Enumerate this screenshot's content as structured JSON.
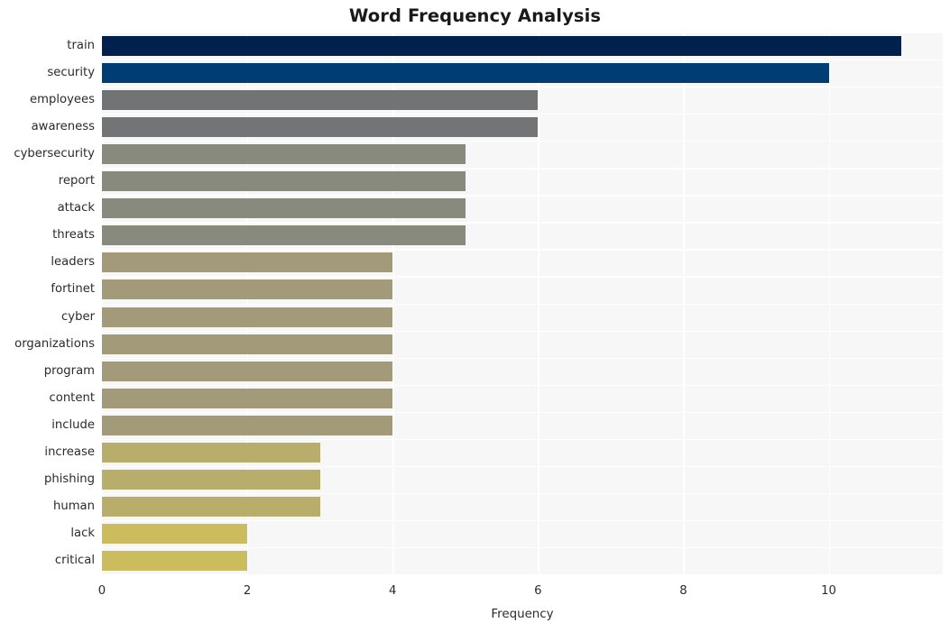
{
  "chart_data": {
    "type": "bar",
    "orientation": "horizontal",
    "title": "Word Frequency Analysis",
    "xlabel": "Frequency",
    "ylabel": "",
    "categories": [
      "train",
      "security",
      "employees",
      "awareness",
      "cybersecurity",
      "report",
      "attack",
      "threats",
      "leaders",
      "fortinet",
      "cyber",
      "organizations",
      "program",
      "content",
      "include",
      "increase",
      "phishing",
      "human",
      "lack",
      "critical"
    ],
    "values": [
      11,
      10,
      6,
      6,
      5,
      5,
      5,
      5,
      4,
      4,
      4,
      4,
      4,
      4,
      4,
      3,
      3,
      3,
      2,
      2
    ],
    "bar_colors": [
      "#00214d",
      "#003d75",
      "#727375",
      "#737476",
      "#888a7d",
      "#888a7d",
      "#888a7d",
      "#888a7d",
      "#a29a78",
      "#a29a78",
      "#a29a78",
      "#a29a78",
      "#a29a78",
      "#a29a78",
      "#a29a78",
      "#b9ad6b",
      "#b9ad6b",
      "#b9ad6b",
      "#ccbc5d",
      "#ccbc5d"
    ],
    "xticks": [
      0,
      2,
      4,
      6,
      8,
      10
    ],
    "xtick_labels": [
      "0",
      "2",
      "4",
      "6",
      "8",
      "10"
    ],
    "xlim": [
      0,
      11.57
    ],
    "grid": true,
    "grid_color": "#ffffff",
    "plot_background": "#f7f7f7",
    "figure_background": "#ffffff",
    "legend": null
  }
}
